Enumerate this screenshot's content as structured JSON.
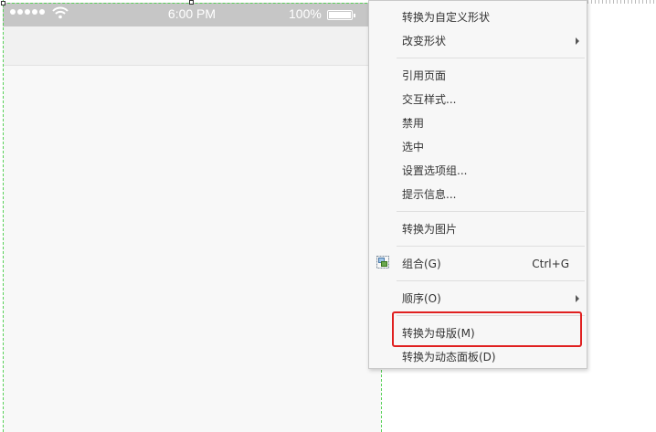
{
  "status_bar": {
    "time": "6:00 PM",
    "battery_percent": "100%",
    "signal_icon": "signal-dots-icon",
    "wifi_icon": "wifi-icon",
    "battery_icon": "battery-icon"
  },
  "context_menu": {
    "items": [
      {
        "label": "转换为自定义形状"
      },
      {
        "label": "改变形状",
        "submenu": true
      },
      {
        "label": "引用页面"
      },
      {
        "label": "交互样式..."
      },
      {
        "label": "禁用"
      },
      {
        "label": "选中"
      },
      {
        "label": "设置选项组..."
      },
      {
        "label": "提示信息..."
      },
      {
        "label": "转换为图片"
      },
      {
        "label": "组合(G)",
        "shortcut": "Ctrl+G",
        "icon": "group-icon"
      },
      {
        "label": "顺序(O)",
        "submenu": true
      },
      {
        "label": "转换为母版(M)",
        "highlighted": true
      },
      {
        "label": "转换为动态面板(D)"
      }
    ]
  },
  "colors": {
    "highlight_border": "#e02020",
    "guide": "#58d158",
    "status_bar_bg": "#c6c6c6"
  }
}
